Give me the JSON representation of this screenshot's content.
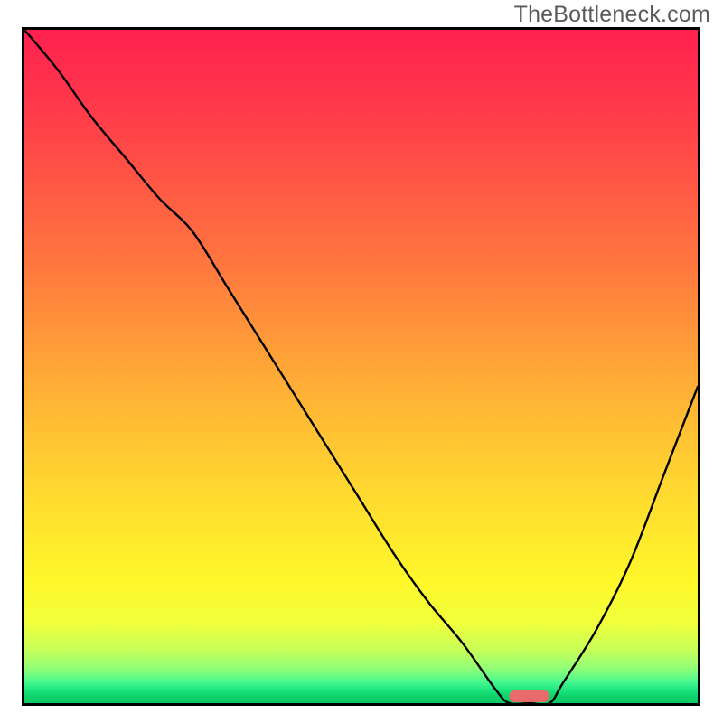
{
  "watermark": {
    "text": "TheBottleneck.com"
  },
  "colors": {
    "axis": "#000000",
    "curve": "#000000",
    "marker": "#e96a6b",
    "gradient_top": "#ff204e",
    "gradient_mid": "#ffe12e",
    "gradient_bottom": "#0ac861"
  },
  "chart_data": {
    "type": "line",
    "title": "",
    "xlabel": "",
    "ylabel": "",
    "xlim": [
      0,
      100
    ],
    "ylim": [
      0,
      100
    ],
    "grid": false,
    "legend": false,
    "x": [
      0,
      5,
      10,
      15,
      20,
      25,
      30,
      35,
      40,
      45,
      50,
      55,
      60,
      65,
      70,
      72,
      75,
      78,
      80,
      85,
      90,
      95,
      100
    ],
    "values": [
      100,
      94,
      87,
      81,
      75,
      70,
      62,
      54,
      46,
      38,
      30,
      22,
      15,
      9,
      2,
      0,
      0,
      0,
      3,
      11,
      21,
      34,
      47
    ],
    "annotations": [
      {
        "name": "optimal-marker",
        "shape": "rounded-bar",
        "x_range": [
          72,
          78
        ],
        "y": 0
      }
    ]
  }
}
